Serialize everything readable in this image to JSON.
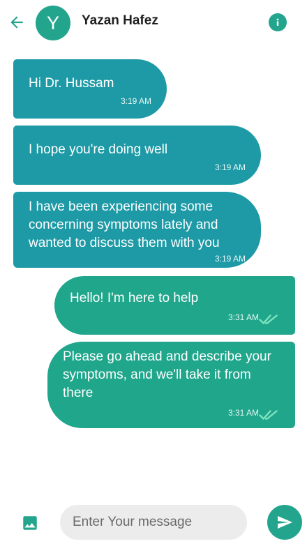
{
  "header": {
    "avatar_initial": "Y",
    "contact_name": "Yazan Hafez",
    "back_icon": "arrow-left-icon",
    "info_icon": "info-icon"
  },
  "messages": [
    {
      "direction": "incoming",
      "text": "Hi Dr. Hussam",
      "time": "3:19 AM"
    },
    {
      "direction": "incoming",
      "text": "I hope you're doing well",
      "time": "3:19 AM"
    },
    {
      "direction": "incoming",
      "text": "I have been experiencing some concerning symptoms lately and wanted to discuss them with you",
      "time": "3:19 AM"
    },
    {
      "direction": "outgoing",
      "text": "Hello! I'm here to help",
      "time": "3:31 AM",
      "status": "read"
    },
    {
      "direction": "outgoing",
      "text": "Please go ahead and describe your symptoms, and we'll take it from there",
      "time": "3:31 AM",
      "status": "read"
    }
  ],
  "composer": {
    "placeholder": "Enter Your message",
    "value": "",
    "image_icon": "image-icon",
    "send_icon": "send-icon"
  },
  "colors": {
    "accent": "#23a58d",
    "incoming_bubble": "#1e9aa6",
    "outgoing_bubble": "#1fa68b",
    "read_ticks": "#7fe3bf"
  }
}
